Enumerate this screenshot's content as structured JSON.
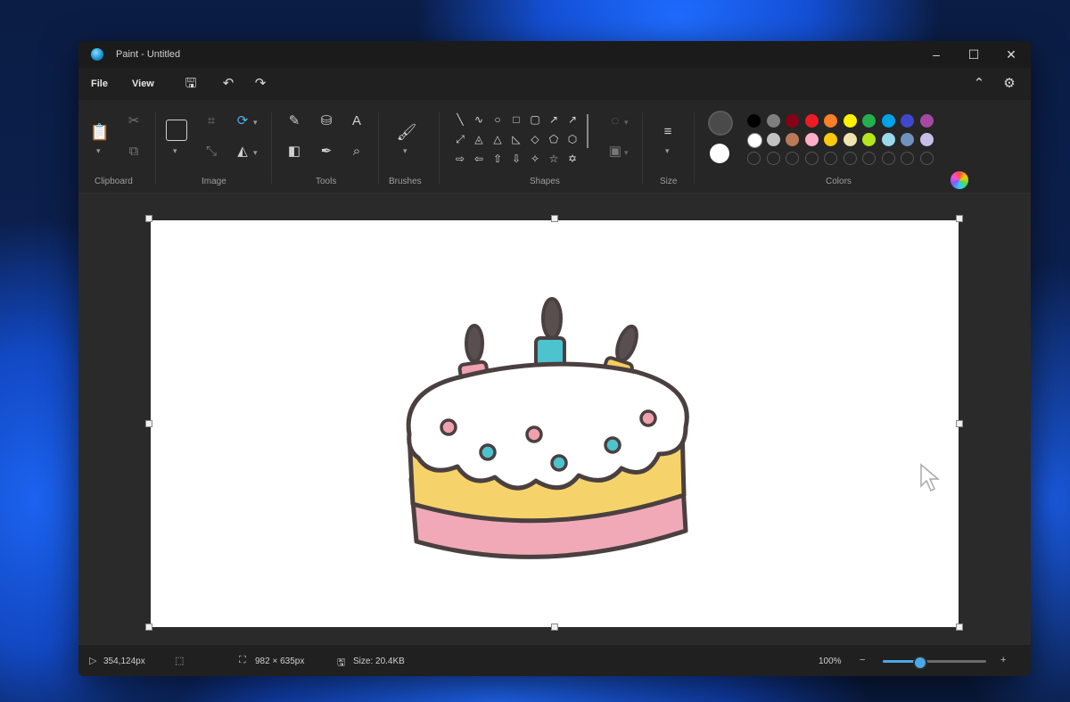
{
  "window": {
    "title": "Paint - Untitled"
  },
  "menu": {
    "file": "File",
    "view": "View"
  },
  "ribbon": {
    "groups": {
      "clipboard": "Clipboard",
      "image": "Image",
      "tools": "Tools",
      "brushes": "Brushes",
      "shapes": "Shapes",
      "size": "Size",
      "colors": "Colors"
    },
    "palette_row1": [
      "#000000",
      "#7f7f7f",
      "#880015",
      "#ed1c24",
      "#ff7f27",
      "#fff200",
      "#22b14c",
      "#00a2e8",
      "#3f48cc",
      "#a349a4"
    ],
    "palette_row2": [
      "#ffffff",
      "#c3c3c3",
      "#b97a57",
      "#ffaec9",
      "#ffc90e",
      "#efe4b0",
      "#b5e61d",
      "#99d9ea",
      "#7092be",
      "#c8bfe7"
    ],
    "primary_color": "#4a4a4a",
    "secondary_color": "#ffffff"
  },
  "status": {
    "cursor_position": "354,124px",
    "canvas_size": "982 × 635px",
    "file_size": "Size: 20.4KB",
    "zoom": "100%",
    "zoom_level": 0.35
  }
}
